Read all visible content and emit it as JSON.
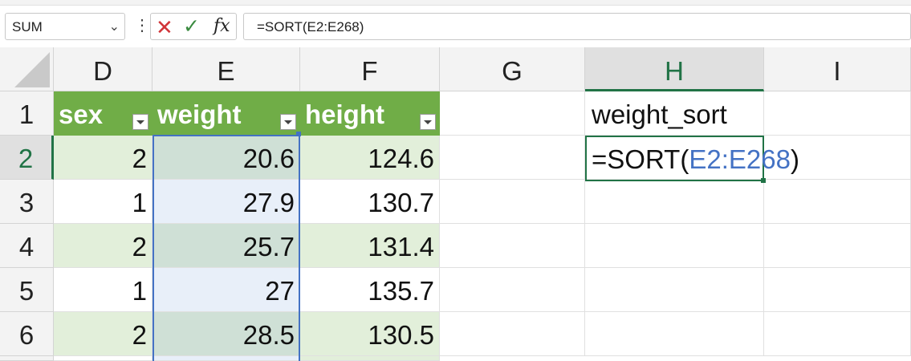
{
  "name_box": {
    "value": "SUM"
  },
  "formula_bar": {
    "formula": "=SORT(E2:E268)",
    "cancel_glyph": "✕",
    "enter_glyph": "✓",
    "fx_label": "fx",
    "more_glyph": "⋮"
  },
  "columns": [
    "D",
    "E",
    "F",
    "G",
    "H",
    "I"
  ],
  "active_column": "H",
  "rows": [
    "1",
    "2",
    "3",
    "4",
    "5",
    "6"
  ],
  "active_row": "2",
  "table": {
    "headers": [
      "sex",
      "weight",
      "height"
    ],
    "rows": [
      [
        "2",
        "20.6",
        "124.6"
      ],
      [
        "1",
        "27.9",
        "130.7"
      ],
      [
        "2",
        "25.7",
        "131.4"
      ],
      [
        "1",
        "27",
        "135.7"
      ],
      [
        "2",
        "28.5",
        "130.5"
      ]
    ]
  },
  "h_column": {
    "header": "weight_sort",
    "edit_prefix": "=SORT(",
    "edit_ref": "E2:E268",
    "edit_suffix": ")"
  },
  "colors": {
    "table_header": "#70ad47",
    "band": "#e2efda",
    "selection": "#4472c4",
    "active_green": "#217346"
  }
}
